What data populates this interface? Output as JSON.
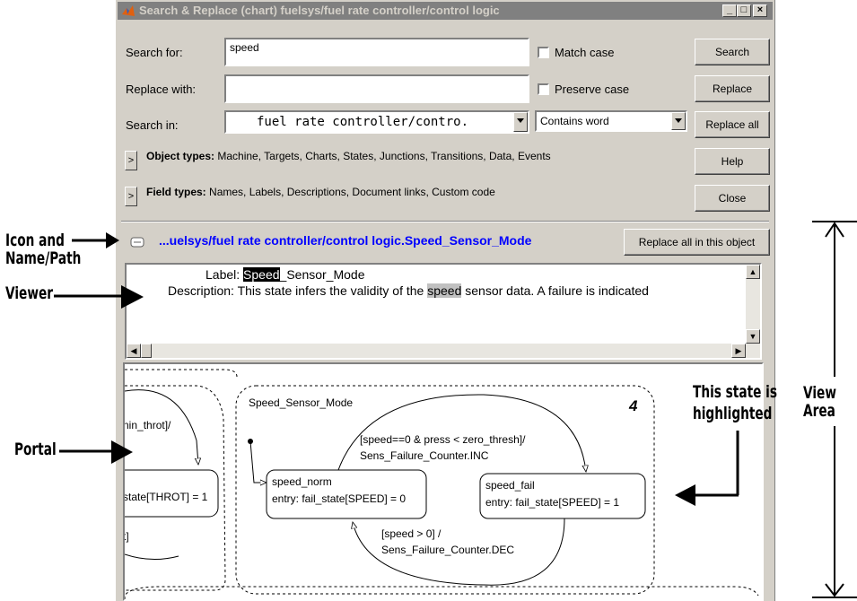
{
  "window": {
    "title": "Search & Replace (chart) fuelsys/fuel rate controller/control logic",
    "min": "_",
    "max": "□",
    "close": "×"
  },
  "search": {
    "label": "Search for:",
    "value": "speed",
    "match_case": "Match case",
    "button": "Search"
  },
  "replace": {
    "label": "Replace with:",
    "value": "",
    "preserve_case": "Preserve case",
    "button": "Replace"
  },
  "search_in": {
    "label": "Search in:",
    "value": "fuel rate controller/contro.",
    "mode": "Contains word",
    "button": "Replace all"
  },
  "object_types": {
    "label": "Object types:",
    "value": "Machine, Targets, Charts, States, Junctions, Transitions, Data, Events",
    "button": "Help",
    "expand": ">"
  },
  "field_types": {
    "label": "Field types:",
    "value": "Names, Labels, Descriptions, Document links, Custom code",
    "button": "Close",
    "expand": ">"
  },
  "result": {
    "path": "...uelsys/fuel rate controller/control logic.Speed_Sensor_Mode",
    "button": "Replace all in this object"
  },
  "viewer": {
    "label_key": "Label:",
    "label_match": "Speed",
    "label_rest": "_Sensor_Mode",
    "desc_key": "Description:",
    "desc_before": "This state infers the validity of the ",
    "desc_match": "speed",
    "desc_after": " sensor data.  A failure is indicated"
  },
  "chart": {
    "left_label1": "nin_throt]/",
    "left_label2": "state[THROT] = 1",
    "left_label3": "t]",
    "superstate": "Speed_Sensor_Mode",
    "number": "4",
    "top_transition1": "[speed==0 & press < zero_thresh]/",
    "top_transition2": "Sens_Failure_Counter.INC",
    "state_norm_name": "speed_norm",
    "state_norm_entry": "entry: fail_state[SPEED] = 0",
    "state_fail_name": "speed_fail",
    "state_fail_entry": "entry: fail_state[SPEED] = 1",
    "bottom_transition1": "[speed > 0] /",
    "bottom_transition2": "Sens_Failure_Counter.DEC"
  },
  "annotations": {
    "icon_name1": "Icon and",
    "icon_name2": "Name/Path",
    "viewer": "Viewer",
    "portal": "Portal",
    "highlighted1": "This state is",
    "highlighted2": "highlighted",
    "view_area1": "View",
    "view_area2": "Area"
  },
  "colors": {
    "titlebar": "#808080",
    "path": "#0000ff",
    "face": "#d4d0c8"
  }
}
